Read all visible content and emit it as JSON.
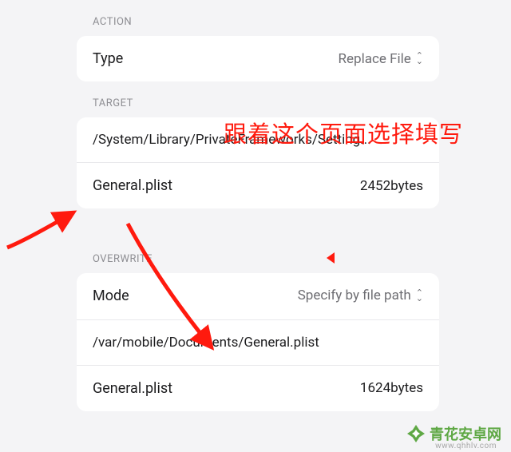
{
  "action": {
    "header": "ACTION",
    "type_label": "Type",
    "type_value": "Replace File"
  },
  "target": {
    "header": "TARGET",
    "path": "/System/Library/PrivateFrameworks/Setting...",
    "file_name": "General.plist",
    "file_size": "2452bytes"
  },
  "overwrite": {
    "header": "OVERWRITE",
    "mode_label": "Mode",
    "mode_value": "Specify by file path",
    "path": "/var/mobile/Documents/General.plist",
    "file_name": "General.plist",
    "file_size": "1624bytes"
  },
  "annotation": {
    "text": "跟着这个页面选择填写"
  },
  "watermark": {
    "name": "青花安卓网",
    "url": "www.qhhlv.com"
  }
}
